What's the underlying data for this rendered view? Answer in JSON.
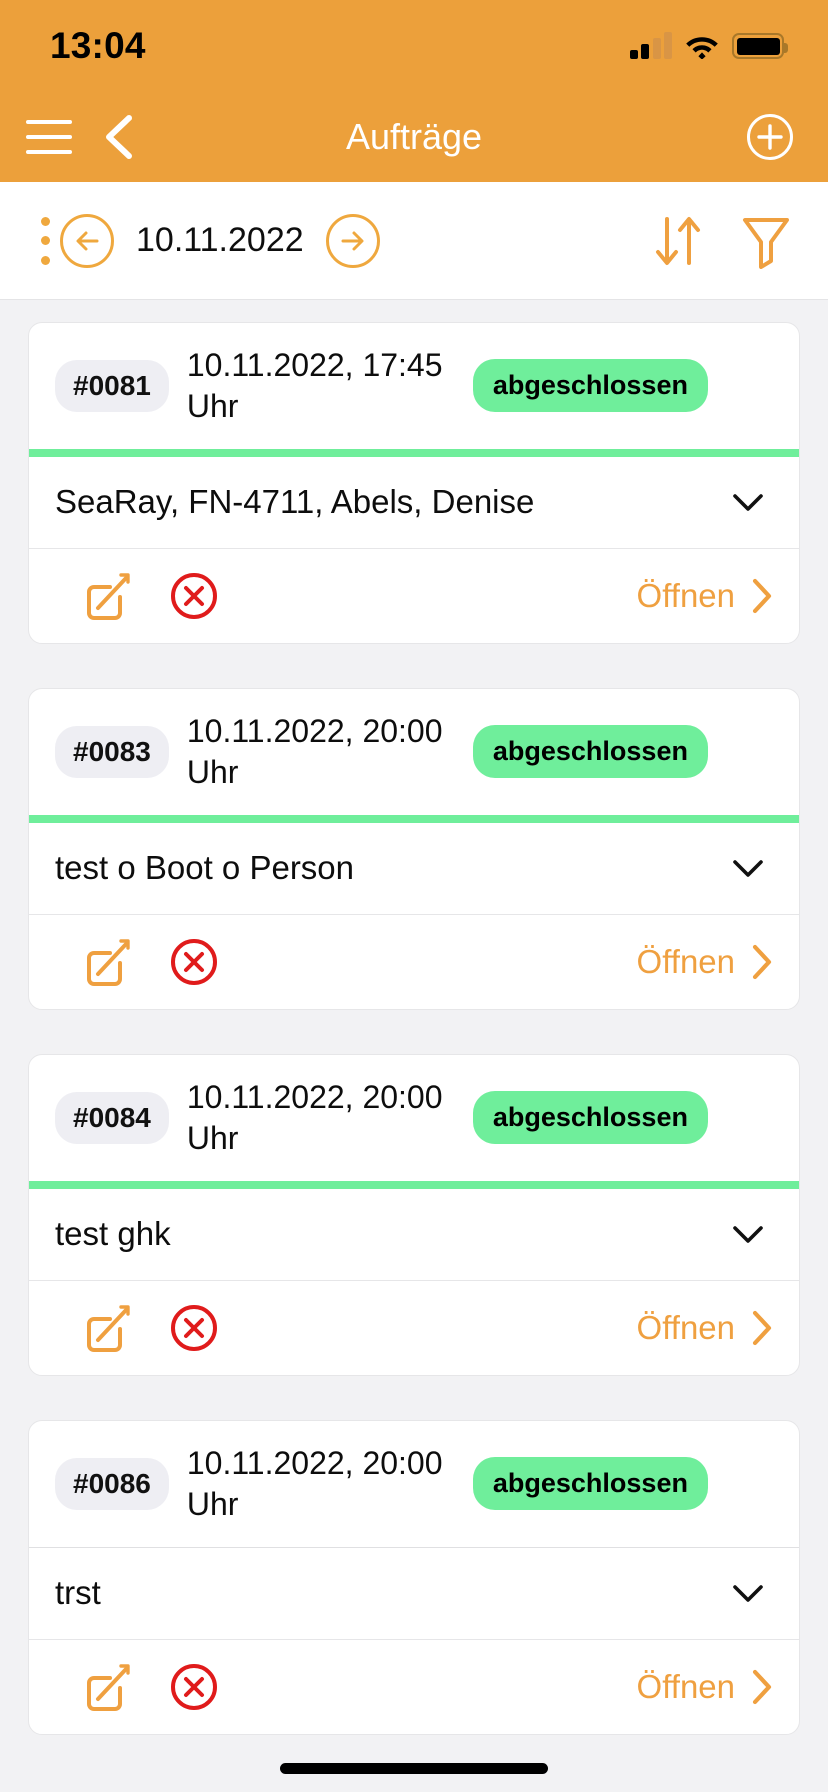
{
  "status_bar": {
    "time": "13:04",
    "icons": [
      "signal-icon",
      "wifi-icon",
      "battery-icon"
    ]
  },
  "nav": {
    "title": "Aufträge",
    "menu_icon": "hamburger-menu-icon",
    "back_icon": "chevron-left-icon",
    "add_icon": "plus-circle-icon"
  },
  "toolbar": {
    "kebab_icon": "more-vertical-icon",
    "prev_icon": "arrow-left-circle-icon",
    "date": "10.11.2022",
    "next_icon": "arrow-right-circle-icon",
    "sort_icon": "sort-updown-icon",
    "filter_icon": "filter-funnel-icon"
  },
  "colors": {
    "accent": "#ECA03B",
    "accent_icon": "#EFA83E",
    "status_green": "#6FEE9B",
    "delete_red": "#E01B1B",
    "page_bg": "#f2f2f4",
    "pill_bg": "#eeeef3"
  },
  "actions": {
    "edit_icon": "edit-square-pencil-icon",
    "delete_icon": "delete-circle-x-icon",
    "open_label": "Öffnen",
    "open_chevron_icon": "chevron-right-icon",
    "expand_icon": "chevron-down-icon"
  },
  "orders": [
    {
      "number": "#0081",
      "datetime": "10.11.2022, 17:45 Uhr",
      "status": "abgeschlossen",
      "status_accent": true,
      "description": "SeaRay, FN-4711, Abels, Denise"
    },
    {
      "number": "#0083",
      "datetime": "10.11.2022, 20:00 Uhr",
      "status": "abgeschlossen",
      "status_accent": true,
      "description": "test o Boot o Person"
    },
    {
      "number": "#0084",
      "datetime": "10.11.2022, 20:00 Uhr",
      "status": "abgeschlossen",
      "status_accent": true,
      "description": "test ghk"
    },
    {
      "number": "#0086",
      "datetime": "10.11.2022, 20:00 Uhr",
      "status": "abgeschlossen",
      "status_accent": false,
      "description": "trst"
    }
  ]
}
